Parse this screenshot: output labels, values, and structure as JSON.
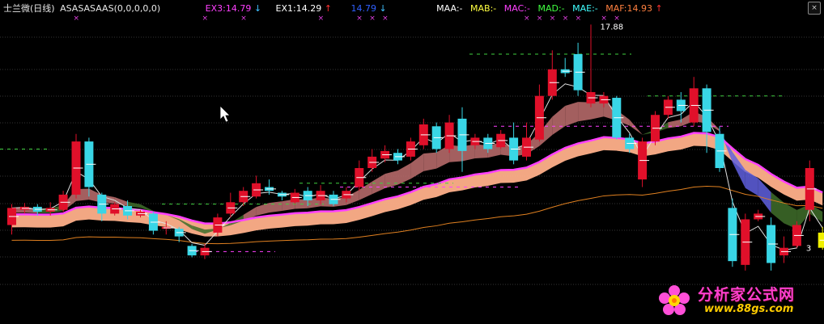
{
  "header": {
    "stock_name": "士兰微(日线)",
    "indicator": "ASASASAAS(0,0,0,0,0)",
    "ex3_label": "EX3:14.79",
    "ex3_arrow": "↓",
    "ex1_label": "EX1:14.29",
    "ex1_arrow": "↑",
    "ex_value": "14.79",
    "ex_value_arrow": "↓",
    "maa": "MAA:-",
    "mab": "MAB:-",
    "mac": "MAC:-",
    "mad": "MAD:-",
    "mae": "MAE:-",
    "maf": "MAF:14.93",
    "maf_arrow": "↑"
  },
  "close_button_label": "×",
  "colors": {
    "background": "#000000",
    "grid": "#333333",
    "up_candle": "#e0102a",
    "down_candle": "#39d6e6",
    "signal_candle": "#f0f000",
    "pink_band": "#ffb08a",
    "magenta_line": "#ff40ff",
    "cloud_pink": "#c07070",
    "cloud_green": "#3f6f2a",
    "cloud_blue": "#6060e0",
    "orange_line": "#e08020",
    "white_line": "#e0e0e0",
    "ex3_color": "#ff40ff",
    "ex1_color": "#ffffff",
    "ex_value_color": "#3060ff",
    "maa_color": "#ffffff",
    "mab_color": "#ffff40",
    "mac_color": "#ff40ff",
    "mad_color": "#40ff40",
    "mae_color": "#40ffff",
    "maf_color": "#ff8040",
    "arrow_red": "#ff3030"
  },
  "chart_data": {
    "type": "candlestick",
    "annotations": [
      {
        "label": "17.88",
        "candle_index": 45
      },
      {
        "label": "3",
        "candle_index": 61
      }
    ],
    "candles": [
      {
        "o": 12.6,
        "c": 13.05,
        "h": 13.15,
        "l": 12.35,
        "dir": "up"
      },
      {
        "o": 13.0,
        "c": 13.08,
        "h": 13.18,
        "l": 12.9,
        "dir": "up"
      },
      {
        "o": 13.08,
        "c": 12.95,
        "h": 13.15,
        "l": 12.85,
        "dir": "down"
      },
      {
        "o": 12.95,
        "c": 13.05,
        "h": 13.2,
        "l": 12.85,
        "dir": "up"
      },
      {
        "o": 13.0,
        "c": 13.4,
        "h": 13.5,
        "l": 12.95,
        "dir": "up"
      },
      {
        "o": 13.4,
        "c": 14.8,
        "h": 15.0,
        "l": 13.3,
        "dir": "up"
      },
      {
        "o": 14.8,
        "c": 13.6,
        "h": 14.9,
        "l": 13.35,
        "dir": "down"
      },
      {
        "o": 13.4,
        "c": 12.9,
        "h": 13.45,
        "l": 12.7,
        "dir": "down"
      },
      {
        "o": 12.9,
        "c": 13.15,
        "h": 13.2,
        "l": 12.85,
        "dir": "up"
      },
      {
        "o": 13.1,
        "c": 12.85,
        "h": 13.25,
        "l": 12.75,
        "dir": "down"
      },
      {
        "o": 12.85,
        "c": 12.95,
        "h": 13.0,
        "l": 12.8,
        "dir": "up"
      },
      {
        "o": 12.9,
        "c": 12.45,
        "h": 12.95,
        "l": 12.35,
        "dir": "down"
      },
      {
        "o": 12.5,
        "c": 12.55,
        "h": 12.7,
        "l": 12.35,
        "dir": "up"
      },
      {
        "o": 12.5,
        "c": 12.3,
        "h": 12.55,
        "l": 12.15,
        "dir": "down"
      },
      {
        "o": 12.05,
        "c": 11.8,
        "h": 12.1,
        "l": 11.75,
        "dir": "down"
      },
      {
        "o": 11.8,
        "c": 12.0,
        "h": 12.1,
        "l": 11.7,
        "dir": "up"
      },
      {
        "o": 12.4,
        "c": 12.8,
        "h": 12.9,
        "l": 12.3,
        "dir": "up"
      },
      {
        "o": 12.9,
        "c": 13.2,
        "h": 13.45,
        "l": 12.8,
        "dir": "up"
      },
      {
        "o": 13.2,
        "c": 13.5,
        "h": 13.6,
        "l": 13.1,
        "dir": "up"
      },
      {
        "o": 13.35,
        "c": 13.7,
        "h": 13.9,
        "l": 13.3,
        "dir": "up"
      },
      {
        "o": 13.6,
        "c": 13.5,
        "h": 13.8,
        "l": 13.4,
        "dir": "down"
      },
      {
        "o": 13.45,
        "c": 13.35,
        "h": 13.5,
        "l": 13.25,
        "dir": "down"
      },
      {
        "o": 13.2,
        "c": 13.45,
        "h": 13.55,
        "l": 13.15,
        "dir": "up"
      },
      {
        "o": 13.5,
        "c": 13.25,
        "h": 13.6,
        "l": 13.1,
        "dir": "down"
      },
      {
        "o": 13.25,
        "c": 13.5,
        "h": 13.65,
        "l": 13.15,
        "dir": "up"
      },
      {
        "o": 13.4,
        "c": 13.15,
        "h": 13.5,
        "l": 13.1,
        "dir": "down"
      },
      {
        "o": 13.3,
        "c": 13.5,
        "h": 13.6,
        "l": 13.2,
        "dir": "up"
      },
      {
        "o": 13.6,
        "c": 14.1,
        "h": 14.3,
        "l": 13.5,
        "dir": "up"
      },
      {
        "o": 14.1,
        "c": 14.4,
        "h": 14.6,
        "l": 14.0,
        "dir": "up"
      },
      {
        "o": 14.35,
        "c": 14.55,
        "h": 14.7,
        "l": 14.25,
        "dir": "up"
      },
      {
        "o": 14.5,
        "c": 14.3,
        "h": 14.6,
        "l": 14.2,
        "dir": "down"
      },
      {
        "o": 14.4,
        "c": 14.8,
        "h": 14.9,
        "l": 14.3,
        "dir": "up"
      },
      {
        "o": 14.7,
        "c": 15.25,
        "h": 15.4,
        "l": 14.6,
        "dir": "up"
      },
      {
        "o": 15.2,
        "c": 14.6,
        "h": 15.3,
        "l": 14.5,
        "dir": "down"
      },
      {
        "o": 14.6,
        "c": 15.3,
        "h": 15.5,
        "l": 14.5,
        "dir": "up"
      },
      {
        "o": 15.4,
        "c": 14.55,
        "h": 15.7,
        "l": 14.0,
        "dir": "down"
      },
      {
        "o": 14.7,
        "c": 14.9,
        "h": 15.0,
        "l": 14.6,
        "dir": "up"
      },
      {
        "o": 14.9,
        "c": 14.6,
        "h": 15.0,
        "l": 14.5,
        "dir": "down"
      },
      {
        "o": 14.65,
        "c": 15.0,
        "h": 15.1,
        "l": 14.6,
        "dir": "up"
      },
      {
        "o": 14.9,
        "c": 14.3,
        "h": 15.3,
        "l": 14.2,
        "dir": "down"
      },
      {
        "o": 14.4,
        "c": 14.9,
        "h": 15.3,
        "l": 14.3,
        "dir": "up"
      },
      {
        "o": 14.85,
        "c": 16.0,
        "h": 16.3,
        "l": 14.8,
        "dir": "up"
      },
      {
        "o": 16.0,
        "c": 16.7,
        "h": 17.2,
        "l": 15.9,
        "dir": "up"
      },
      {
        "o": 16.7,
        "c": 16.6,
        "h": 17.0,
        "l": 16.5,
        "dir": "down"
      },
      {
        "o": 17.1,
        "c": 16.15,
        "h": 17.4,
        "l": 16.0,
        "dir": "down"
      },
      {
        "o": 16.1,
        "c": 15.8,
        "h": 17.88,
        "l": 15.7,
        "dir": "up"
      },
      {
        "o": 15.8,
        "c": 16.0,
        "h": 16.1,
        "l": 15.7,
        "dir": "up"
      },
      {
        "o": 15.95,
        "c": 14.9,
        "h": 16.0,
        "l": 14.85,
        "dir": "down"
      },
      {
        "o": 14.9,
        "c": 14.6,
        "h": 15.0,
        "l": 14.5,
        "dir": "down"
      },
      {
        "o": 14.8,
        "c": 13.8,
        "h": 14.9,
        "l": 13.6,
        "dir": "up"
      },
      {
        "o": 14.8,
        "c": 15.5,
        "h": 15.6,
        "l": 14.7,
        "dir": "up"
      },
      {
        "o": 15.5,
        "c": 15.9,
        "h": 16.0,
        "l": 15.4,
        "dir": "up"
      },
      {
        "o": 15.9,
        "c": 15.6,
        "h": 16.1,
        "l": 15.3,
        "dir": "down"
      },
      {
        "o": 15.3,
        "c": 16.2,
        "h": 16.5,
        "l": 15.2,
        "dir": "up"
      },
      {
        "o": 16.2,
        "c": 15.05,
        "h": 16.3,
        "l": 14.5,
        "dir": "down"
      },
      {
        "o": 15.0,
        "c": 14.1,
        "h": 15.2,
        "l": 14.0,
        "dir": "down"
      },
      {
        "o": 13.05,
        "c": 11.65,
        "h": 13.3,
        "l": 11.5,
        "dir": "down"
      },
      {
        "o": 12.75,
        "c": 11.55,
        "h": 12.9,
        "l": 11.4,
        "dir": "up"
      },
      {
        "o": 12.9,
        "c": 12.75,
        "h": 13.0,
        "l": 12.7,
        "dir": "up"
      },
      {
        "o": 12.6,
        "c": 11.6,
        "h": 12.8,
        "l": 11.4,
        "dir": "down"
      },
      {
        "o": 12.0,
        "c": 11.8,
        "h": 12.3,
        "l": 11.6,
        "dir": "up"
      },
      {
        "o": 12.6,
        "c": 12.05,
        "h": 12.7,
        "l": 12.0,
        "dir": "up"
      },
      {
        "o": 13.0,
        "c": 14.1,
        "h": 14.3,
        "l": 12.7,
        "dir": "up"
      },
      {
        "o": 12.4,
        "c": 12.0,
        "h": 12.55,
        "l": 11.95,
        "dir": "signal"
      }
    ]
  }
}
